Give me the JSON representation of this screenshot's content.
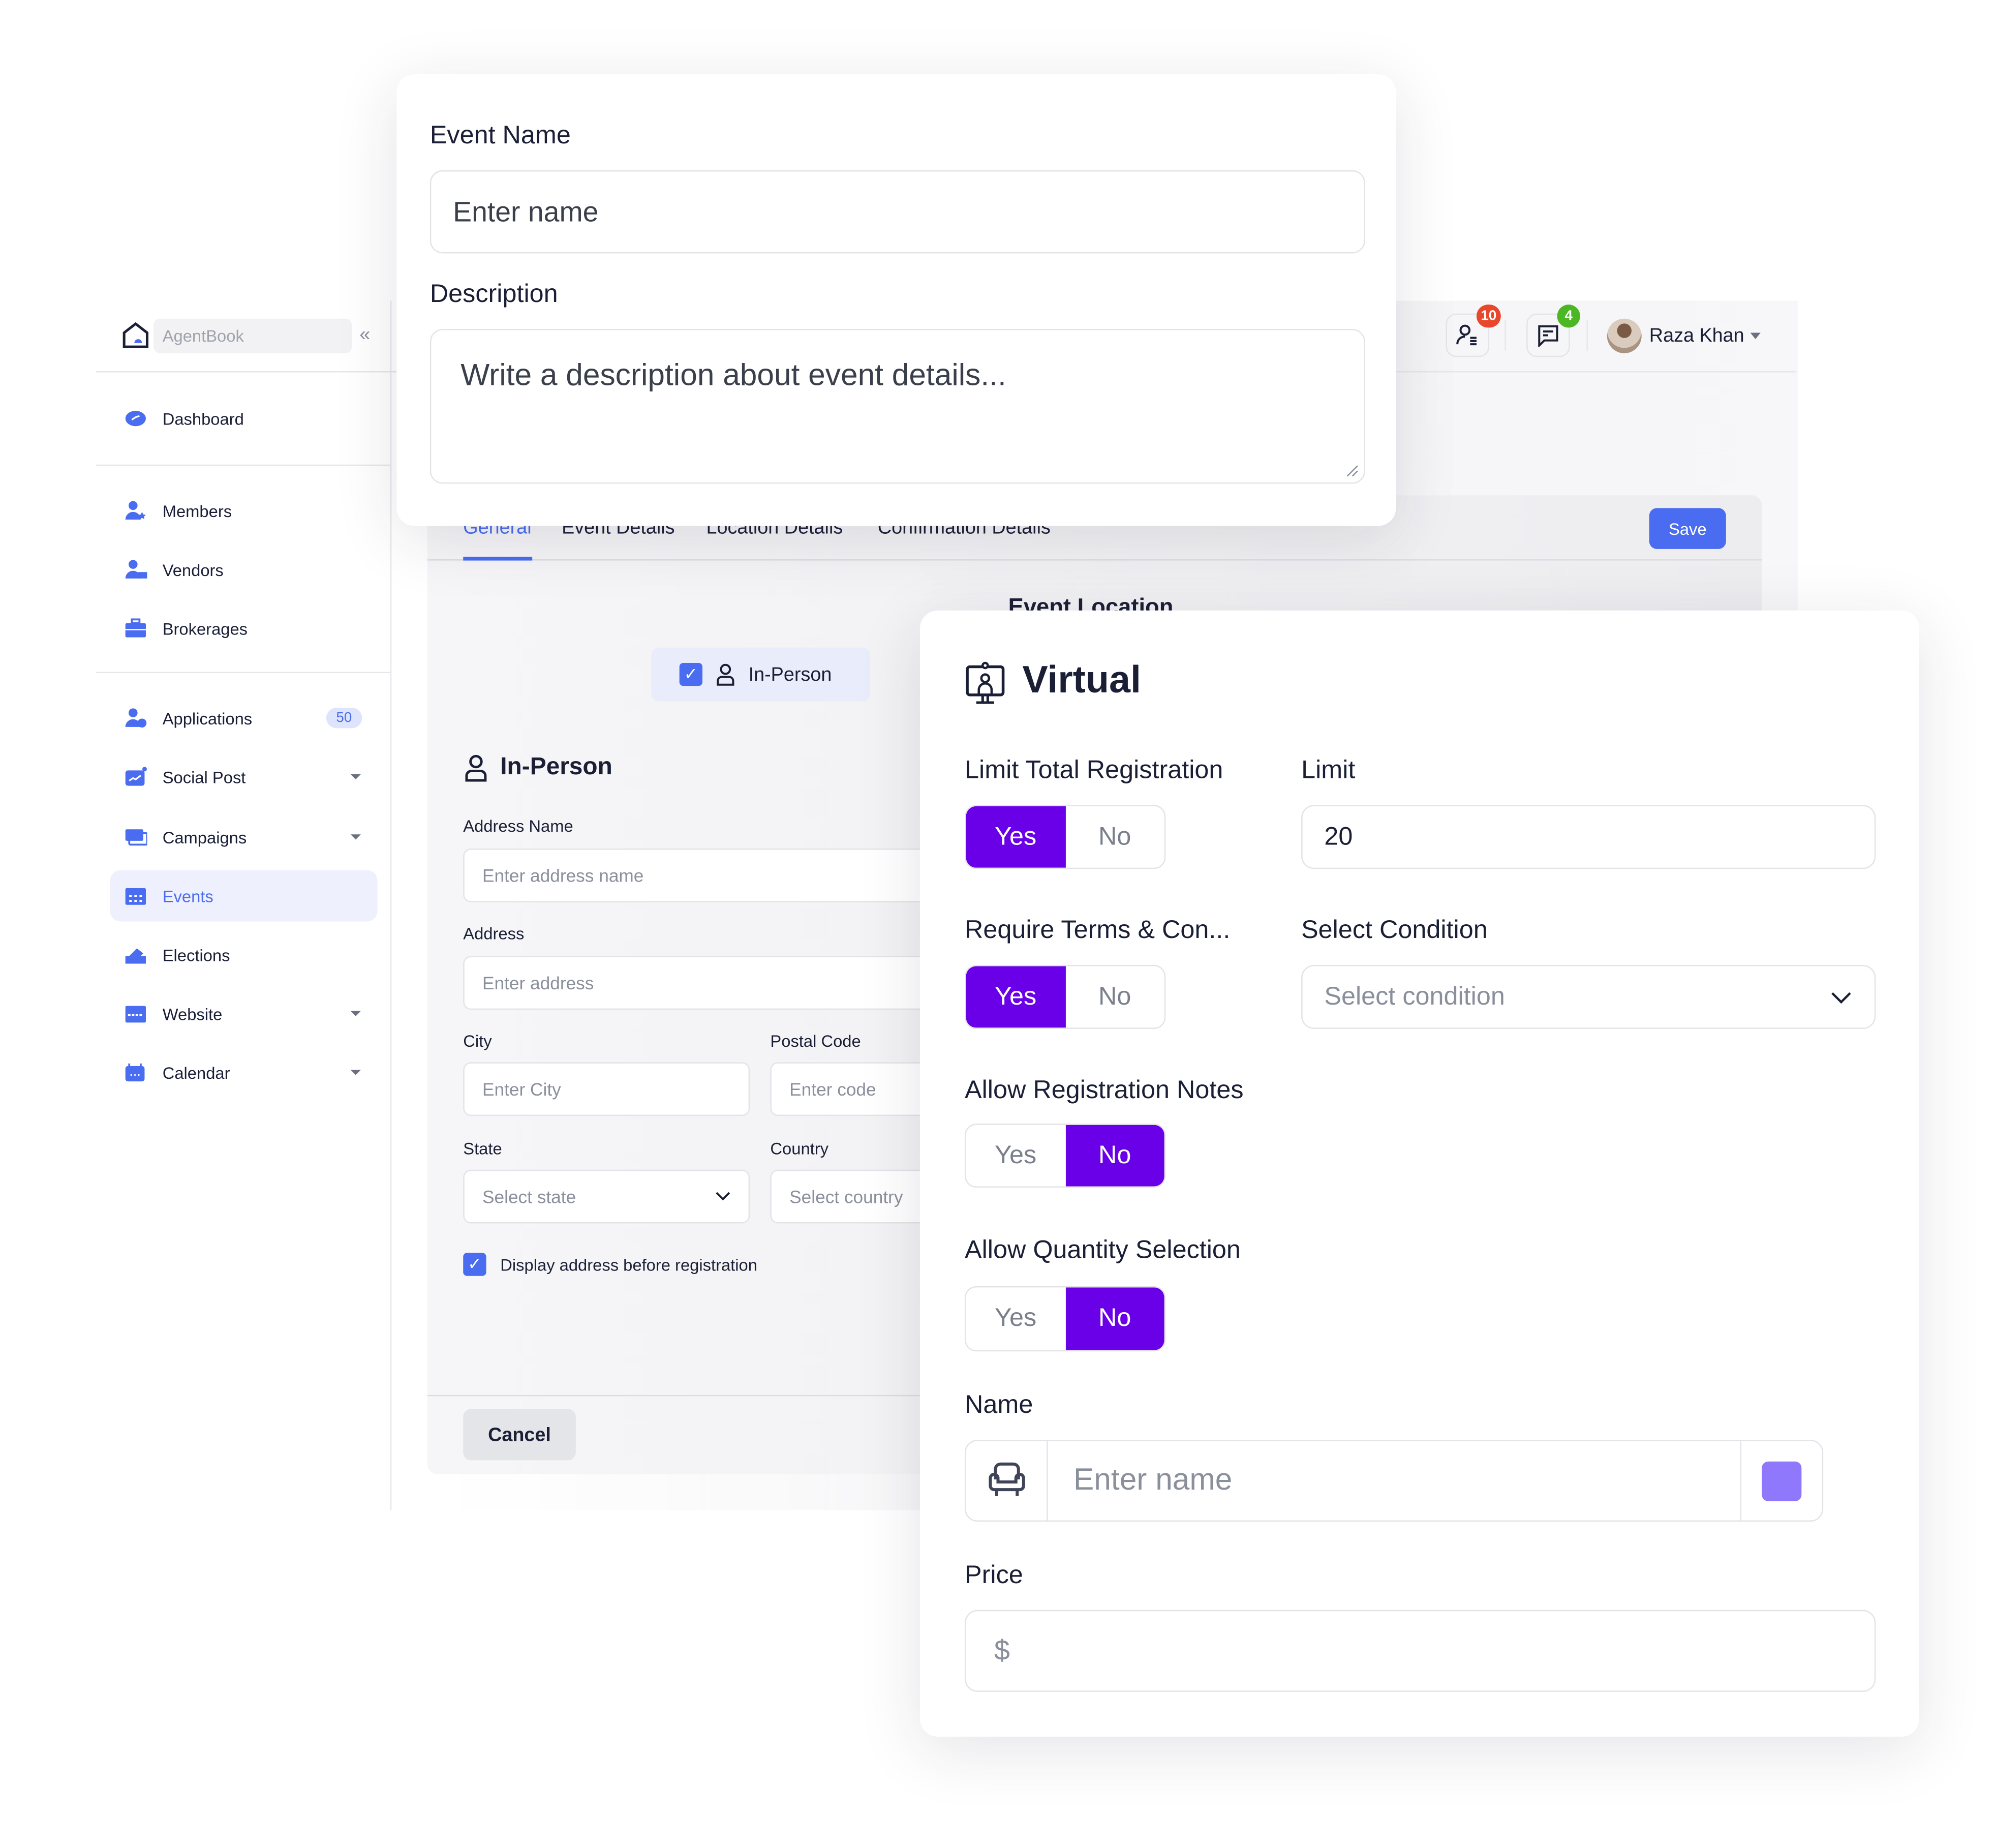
{
  "app": {
    "brand": "AgentBook",
    "collapse_icon": "«"
  },
  "sidebar": {
    "items": [
      {
        "label": "Dashboard",
        "icon": "dashboard-icon"
      },
      {
        "label": "Members",
        "icon": "members-icon"
      },
      {
        "label": "Vendors",
        "icon": "vendors-icon"
      },
      {
        "label": "Brokerages",
        "icon": "briefcase-icon"
      },
      {
        "label": "Applications",
        "icon": "applications-icon",
        "badge": "50"
      },
      {
        "label": "Social Post",
        "icon": "social-post-icon"
      },
      {
        "label": "Campaigns",
        "icon": "campaigns-icon"
      },
      {
        "label": "Events",
        "icon": "calendar-grid-icon",
        "active": true
      },
      {
        "label": "Elections",
        "icon": "ballot-icon"
      },
      {
        "label": "Website",
        "icon": "website-icon"
      },
      {
        "label": "Calendar",
        "icon": "calendar-icon"
      }
    ]
  },
  "header": {
    "notifications_count": "10",
    "messages_count": "4",
    "user_name": "Raza Khan",
    "colors": {
      "notif": "#e8472b",
      "msg": "#4cb725"
    }
  },
  "main": {
    "tabs": [
      "General",
      "Event Details",
      "Location Details",
      "Confirmation Details"
    ],
    "active_tab": "General",
    "save_label": "Save",
    "section_title": "Event Location",
    "chip_label": "In-Person",
    "inperson_title": "In-Person",
    "address_name_label": "Address Name",
    "address_name_placeholder": "Enter address name",
    "address_label": "Address",
    "address_placeholder": "Enter address",
    "city_label": "City",
    "city_placeholder": "Enter City",
    "postal_label": "Postal Code",
    "postal_placeholder": "Enter code",
    "state_label": "State",
    "state_placeholder": "Select state",
    "country_label": "Country",
    "country_placeholder": "Select country",
    "display_address_label": "Display address before registration",
    "cancel_label": "Cancel"
  },
  "event_card": {
    "name_label": "Event Name",
    "name_placeholder": "Enter name",
    "desc_label": "Description",
    "desc_placeholder": "Write a description about event details..."
  },
  "virtual_card": {
    "title": "Virtual",
    "limit_total_label": "Limit Total Registration",
    "limit_total": "Yes",
    "limit_label": "Limit",
    "limit_value": "20",
    "terms_label": "Require Terms & Con...",
    "terms": "Yes",
    "condition_label": "Select Condition",
    "condition_placeholder": "Select condition",
    "notes_label": "Allow Registration Notes",
    "notes": "No",
    "quantity_label": "Allow Quantity Selection",
    "quantity": "No",
    "yes": "Yes",
    "no": "No",
    "name_label": "Name",
    "name_placeholder": "Enter name",
    "swatch_color": "#8f78fb",
    "price_label": "Price",
    "price_prefix": "$"
  },
  "colors": {
    "accent": "#4a6cf0",
    "toggle_on": "#6a00e8"
  }
}
